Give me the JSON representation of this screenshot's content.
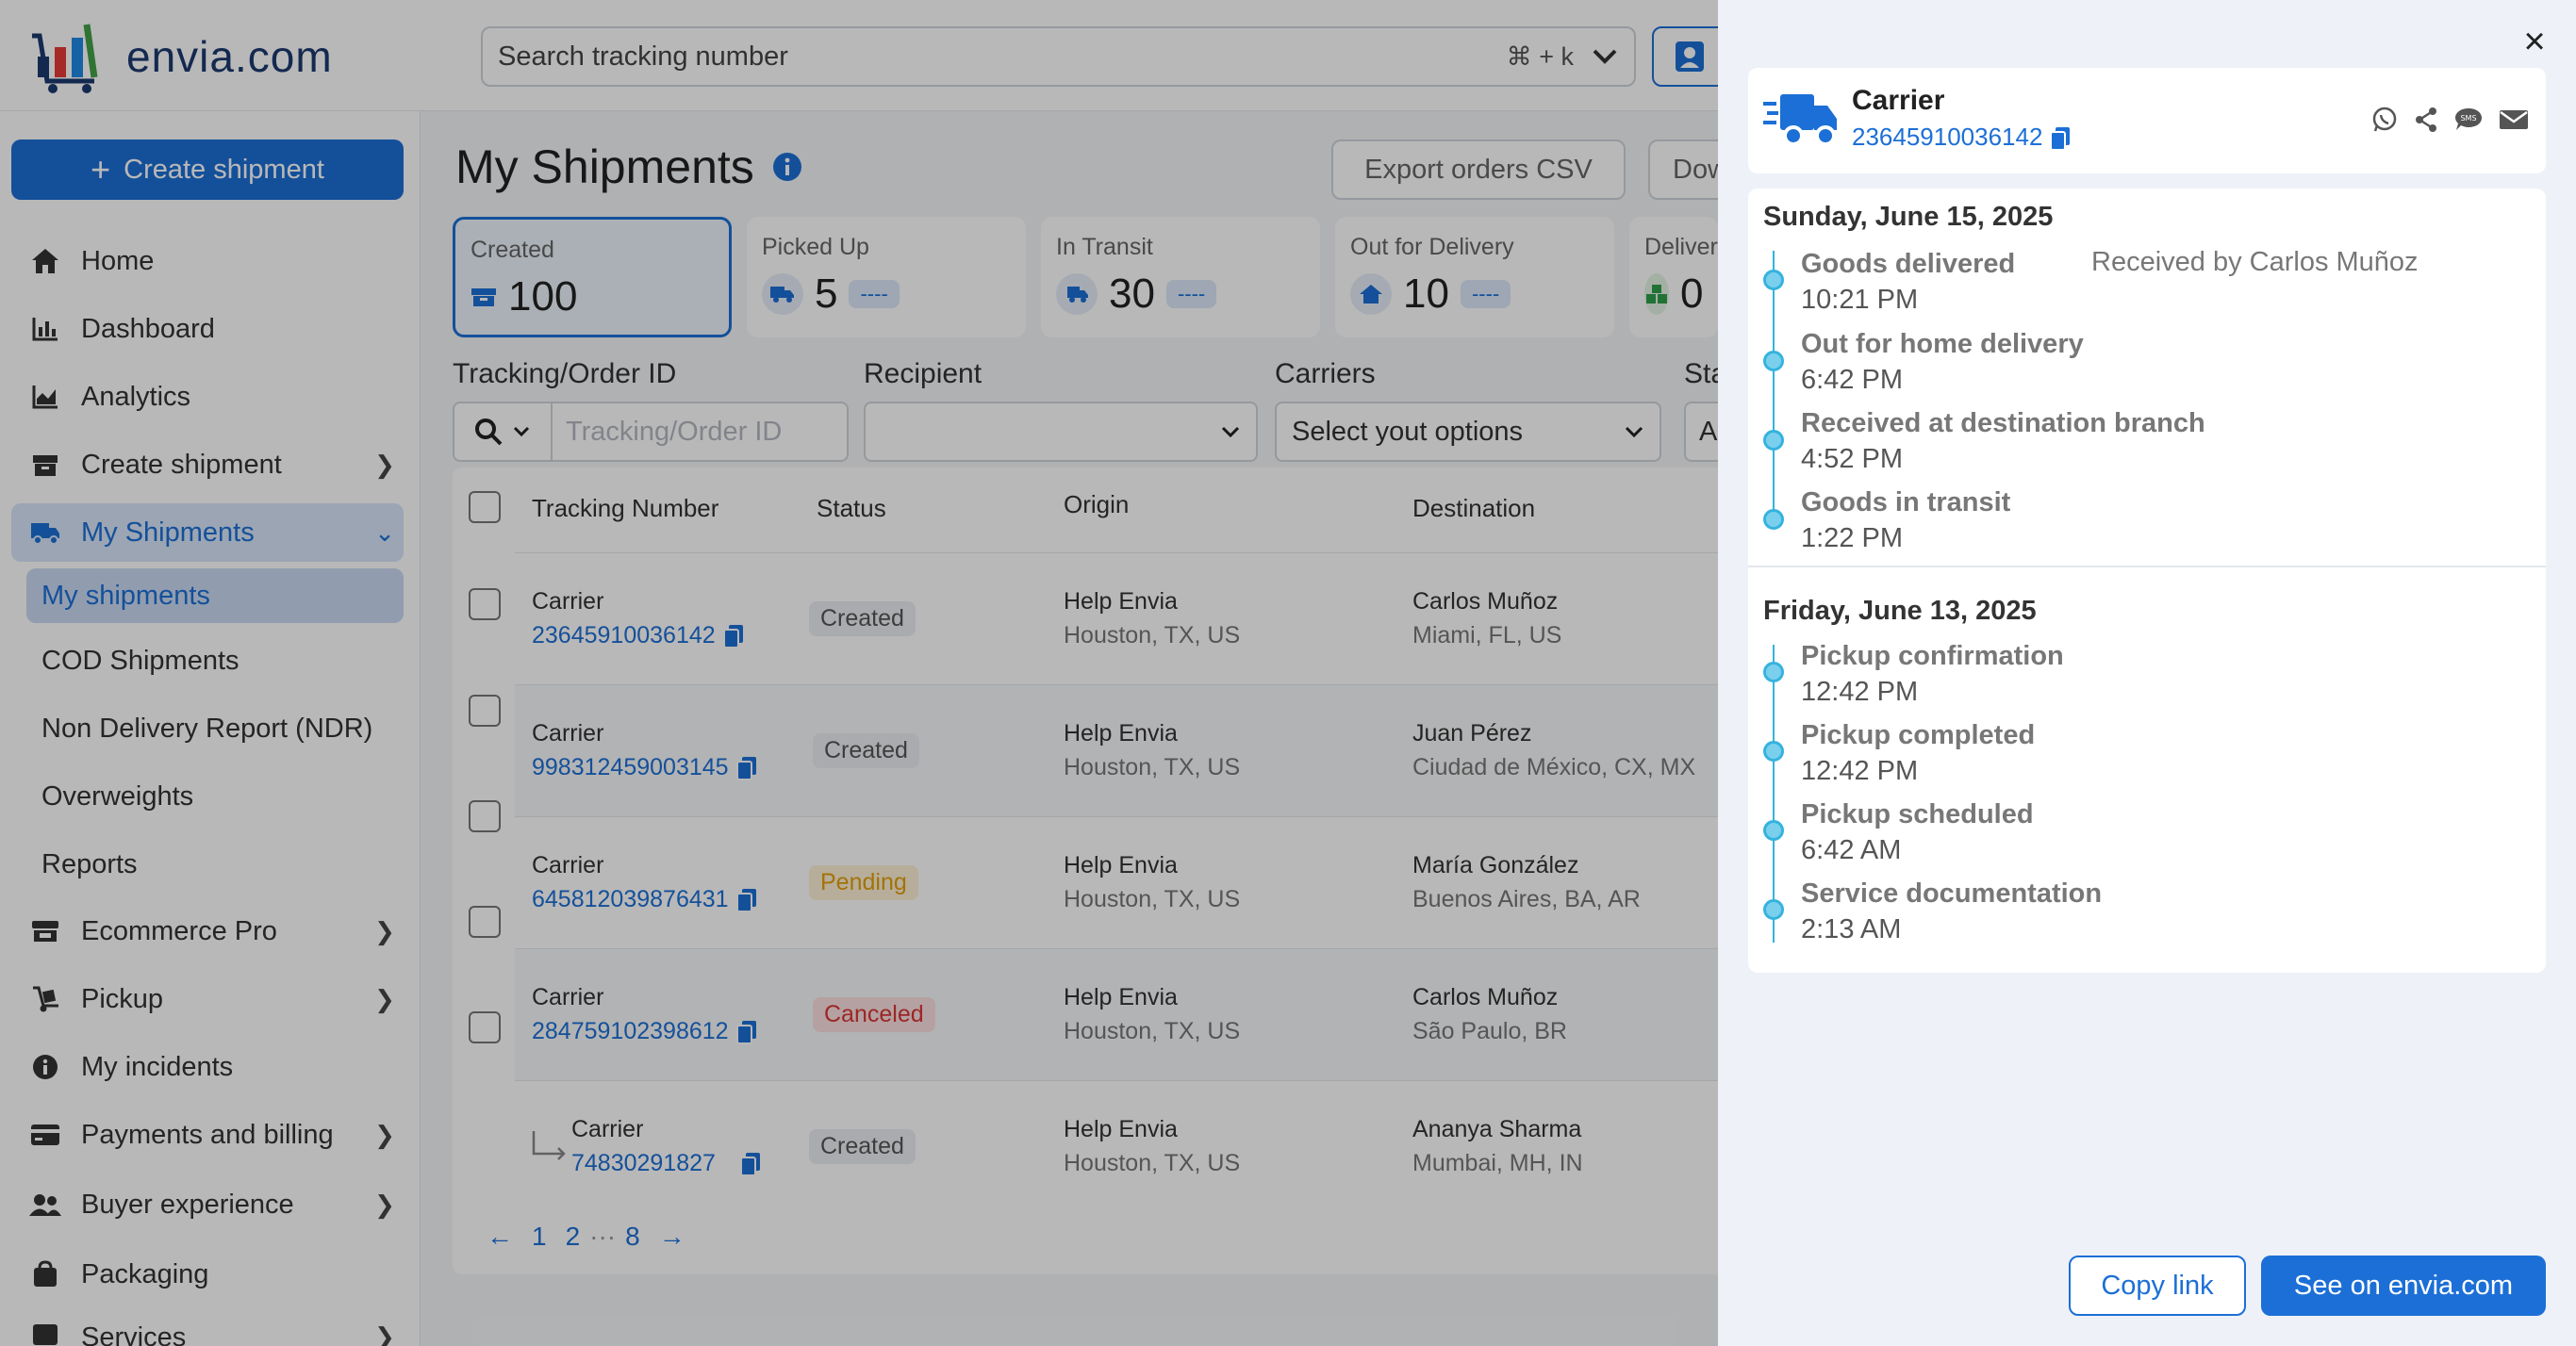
{
  "brand": {
    "logo_text": "envia.com"
  },
  "search": {
    "placeholder": "Search tracking number",
    "shortcut": "⌘ + k"
  },
  "sidebar": {
    "create_label": "Create shipment",
    "items": [
      {
        "label": "Home",
        "icon": "home-icon"
      },
      {
        "label": "Dashboard",
        "icon": "dashboard-icon"
      },
      {
        "label": "Analytics",
        "icon": "analytics-icon"
      },
      {
        "label": "Create shipment",
        "icon": "box-icon"
      },
      {
        "label": "My Shipments",
        "icon": "truck-icon"
      },
      {
        "label": "Ecommerce Pro",
        "icon": "store-icon"
      },
      {
        "label": "Pickup",
        "icon": "dolly-icon"
      },
      {
        "label": "My incidents",
        "icon": "info-icon"
      },
      {
        "label": "Payments and billing",
        "icon": "card-icon"
      },
      {
        "label": "Buyer experience",
        "icon": "users-icon"
      },
      {
        "label": "Packaging",
        "icon": "bag-icon"
      },
      {
        "label": "Services",
        "icon": "services-icon"
      }
    ],
    "sub_items": [
      "My shipments",
      "COD Shipments",
      "Non Delivery Report (NDR)",
      "Overweights",
      "Reports"
    ]
  },
  "main": {
    "title": "My Shipments",
    "export_label": "Export orders CSV",
    "download_label": "Dow",
    "cards": [
      {
        "label": "Created",
        "value": "100",
        "tag": ""
      },
      {
        "label": "Picked Up",
        "value": "5",
        "tag": "----"
      },
      {
        "label": "In Transit",
        "value": "30",
        "tag": "----"
      },
      {
        "label": "Out for Delivery",
        "value": "10",
        "tag": "----"
      },
      {
        "label": "Delivere",
        "value": "0",
        "tag": ""
      }
    ],
    "filters": {
      "tracking_label": "Tracking/Order ID",
      "tracking_placeholder": "Tracking/Order ID",
      "recipient_label": "Recipient",
      "carriers_label": "Carriers",
      "carriers_value": "Select yout options",
      "status_label": "Sta",
      "status_value": "A"
    },
    "table": {
      "headers": [
        "Tracking Number",
        "Status",
        "Origin",
        "Destination"
      ],
      "rows": [
        {
          "carrier": "Carrier",
          "tracking": "23645910036142",
          "status": "Created",
          "origin_name": "Help Envia",
          "origin_loc": "Houston, TX, US",
          "dest_name": "Carlos Muñoz",
          "dest_loc": "Miami, FL, US"
        },
        {
          "carrier": "Carrier",
          "tracking": "998312459003145",
          "status": "Created",
          "origin_name": "Help Envia",
          "origin_loc": "Houston, TX, US",
          "dest_name": "Juan Pérez",
          "dest_loc": "Ciudad de México, CX, MX"
        },
        {
          "carrier": "Carrier",
          "tracking": "645812039876431",
          "status": "Pending",
          "origin_name": "Help Envia",
          "origin_loc": "Houston, TX, US",
          "dest_name": "María González",
          "dest_loc": "Buenos Aires, BA, AR"
        },
        {
          "carrier": "Carrier",
          "tracking": "284759102398612",
          "status": "Canceled",
          "origin_name": "Help Envia",
          "origin_loc": "Houston, TX, US",
          "dest_name": "Carlos Muñoz",
          "dest_loc": "São Paulo, BR"
        },
        {
          "carrier": "Carrier",
          "tracking": "74830291827",
          "status": "Created",
          "origin_name": "Help Envia",
          "origin_loc": "Houston, TX, US",
          "dest_name": "Ananya Sharma",
          "dest_loc": "Mumbai, MH, IN"
        }
      ]
    },
    "pagination": {
      "pages": [
        "1",
        "2",
        "8"
      ],
      "ellipsis": "···"
    }
  },
  "panel": {
    "carrier": "Carrier",
    "tracking": "23645910036142",
    "days": [
      {
        "date": "Sunday, June 15, 2025",
        "events": [
          {
            "title": "Goods delivered",
            "time": "10:21 PM",
            "note": "Received by Carlos Muñoz"
          },
          {
            "title": "Out for home delivery",
            "time": "6:42 PM"
          },
          {
            "title": "Received at destination branch",
            "time": "4:52 PM"
          },
          {
            "title": "Goods in transit",
            "time": "1:22 PM"
          }
        ]
      },
      {
        "date": "Friday, June 13, 2025",
        "events": [
          {
            "title": "Pickup confirmation",
            "time": "12:42 PM"
          },
          {
            "title": "Pickup completed",
            "time": "12:42 PM"
          },
          {
            "title": "Pickup scheduled",
            "time": "6:42 AM"
          },
          {
            "title": "Service documentation",
            "time": "2:13 AM"
          }
        ]
      }
    ],
    "copy_link": "Copy link",
    "see_on": "See on envia.com"
  },
  "colors": {
    "accent": "#1c6fd6",
    "timeline": "#35b3de",
    "pending": "#e59e0c",
    "canceled": "#d93535"
  }
}
